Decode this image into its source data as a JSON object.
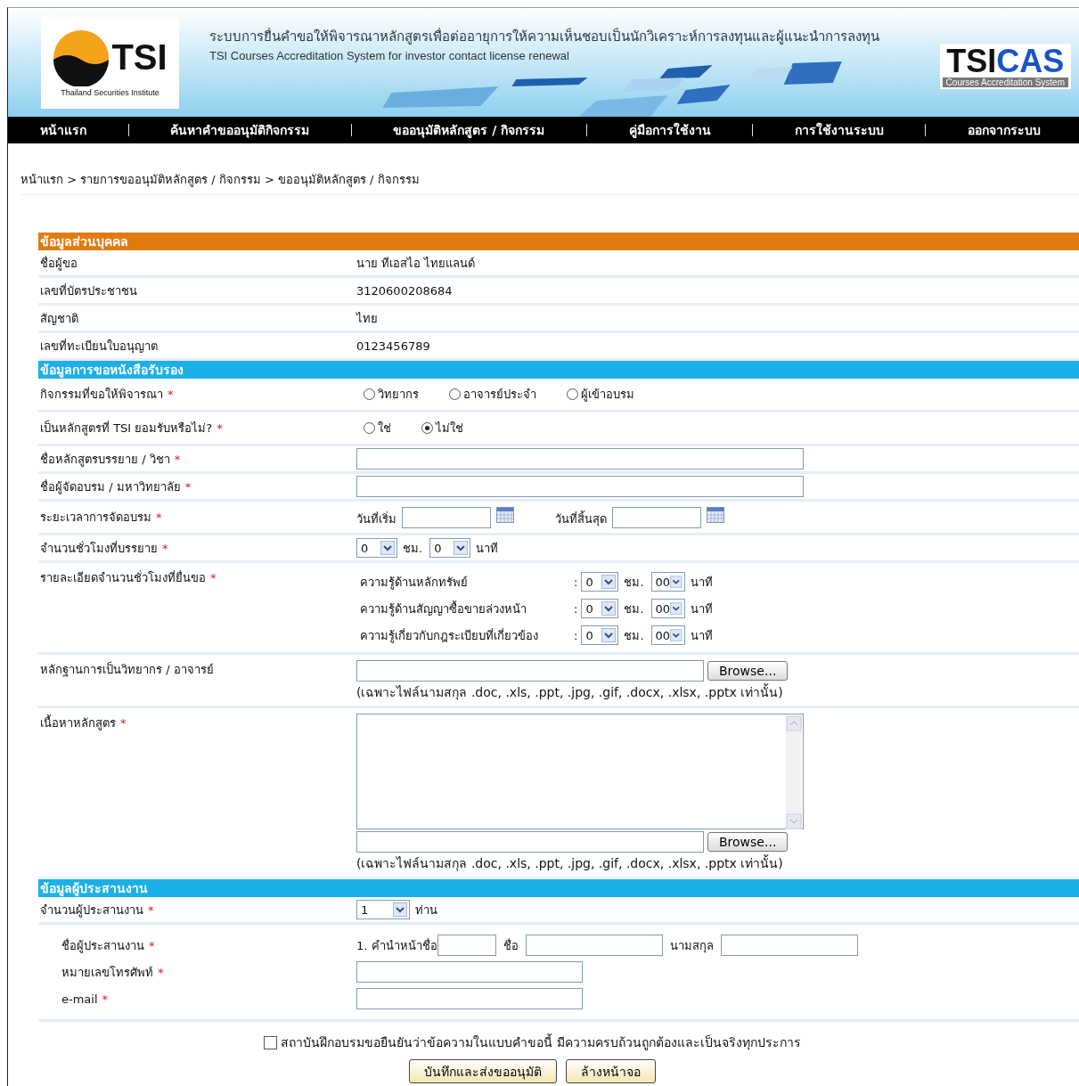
{
  "header": {
    "logo_mark": "TSI",
    "logo_caption": "Thailand Securities Institute",
    "title_th": "ระบบการยื่นคำขอให้พิจารณาหลักสูตรเพื่อต่ออายุการให้ความเห็นชอบเป็นนักวิเคราะห์การลงทุนและผู้แนะนำการลงทุน",
    "title_en": "TSI Courses Accreditation System for investor contact license renewal",
    "brand_a": "TSI",
    "brand_b": "CAS",
    "brand_caption": "Courses Accreditation System"
  },
  "nav": [
    {
      "label": "หน้าแรก"
    },
    {
      "label": "ค้นหาคำขออนุมัติกิจกรรม"
    },
    {
      "label": "ขออนุมัติหลักสูตร / กิจกรรม"
    },
    {
      "label": "คู่มือการใช้งาน"
    },
    {
      "label": "การใช้งานระบบ"
    },
    {
      "label": "ออกจากระบบ"
    }
  ],
  "breadcrumb": "หน้าแรก > รายการขออนุมัติหลักสูตร / กิจกรรม > ขออนุมัติหลักสูตร / กิจกรรม",
  "sections": [
    {
      "title": "ข้อมูลส่วนบุคคล",
      "color": "#e07b10",
      "rows": [
        {
          "kind": "info",
          "label": "ชื่อผู้ขอ",
          "value": "นาย ทีเอสไอ ไทยแลนด์"
        },
        {
          "kind": "info",
          "label": "เลขที่บัตรประชาชน",
          "value": "3120600208684"
        },
        {
          "kind": "info",
          "label": "สัญชาติ",
          "value": "ไทย"
        },
        {
          "kind": "info",
          "label": "เลขที่ทะเบียนใบอนุญาต",
          "value": "0123456789"
        }
      ]
    },
    {
      "title": "ข้อมูลการขอหนังสือรับรอง",
      "color": "#1cb0e8",
      "rows": [
        {
          "kind": "radio",
          "label": "กิจกรรมที่ขอให้พิจารณา",
          "mark": "*",
          "options": [
            {
              "label": "วิทยากร",
              "selected": false
            },
            {
              "label": "อาจารย์ประจำ",
              "selected": false
            },
            {
              "label": "ผู้เข้าอบรม",
              "selected": false
            }
          ]
        },
        {
          "kind": "radio",
          "label": "เป็นหลักสูตรที่ TSI ยอมรับหรือไม่?",
          "mark": "*",
          "options": [
            {
              "label": "ใช่",
              "selected": false
            },
            {
              "label": "ไม่ใช่",
              "selected": true
            }
          ]
        },
        {
          "kind": "text",
          "label": "ชื่อหลักสูตรบรรยาย / วิชา",
          "mark": "*"
        },
        {
          "kind": "text",
          "label": "ชื่อผู้จัดอบรม / มหาวิทยาลัย",
          "mark": "*"
        },
        {
          "kind": "dates",
          "label": "ระยะเวลาการจัดอบรม",
          "mark": "*",
          "start_label": "วันที่เริ่ม",
          "end_label": "วันที่สิ้นสุด"
        },
        {
          "kind": "duration",
          "label": "จำนวนชั่วโมงที่บรรยาย",
          "mark": "*",
          "hours": "0",
          "hours_unit": "ชม.",
          "minutes": "0",
          "minutes_unit": "นาที"
        },
        {
          "kind": "breakdown",
          "label": "รายละเอียดจำนวนชั่วโมงที่ยื่นขอ",
          "mark": "*",
          "items": [
            {
              "label": "ความรู้ด้านหลักทรัพย์",
              "sep": ":",
              "hours": "0",
              "hours_unit": "ชม.",
              "minutes": "00",
              "minutes_unit": "นาที"
            },
            {
              "label": "ความรู้ด้านสัญญาซื้อขายล่วงหน้า",
              "sep": ":",
              "hours": "0",
              "hours_unit": "ชม.",
              "minutes": "00",
              "minutes_unit": "นาที"
            },
            {
              "label": "ความรู้เกี่ยวกับกฎระเบียบที่เกี่ยวข้อง",
              "sep": ":",
              "hours": "0",
              "hours_unit": "ชม.",
              "minutes": "00",
              "minutes_unit": "นาที"
            }
          ]
        },
        {
          "kind": "file",
          "label": "หลักฐานการเป็นวิทยากร / อาจารย์",
          "button": "Browse...",
          "note": "(เฉพาะไฟล์นามสกุล .doc, .xls, .ppt, .jpg, .gif, .docx, .xlsx, .pptx เท่านั้น)"
        },
        {
          "kind": "content",
          "label": "เนื้อหาหลักสูตร",
          "mark": "*",
          "button": "Browse...",
          "note": "(เฉพาะไฟล์นามสกุล .doc, .xls, .ppt, .jpg, .gif, .docx, .xlsx, .pptx เท่านั้น)"
        }
      ]
    },
    {
      "title": "ข้อมูลผู้ประสานงาน",
      "color": "#1cb0e8",
      "rows": [
        {
          "kind": "count",
          "label": "จำนวนผู้ประสานงาน",
          "mark": "*",
          "value": "1",
          "unit": "ท่าน"
        },
        {
          "kind": "contact",
          "lines": [
            {
              "kind": "name",
              "label": "ชื่อผู้ประสานงาน",
              "mark": "*",
              "prefix_label": "1. คำนำหน้าชื่อ",
              "first_label": "ชื่อ",
              "last_label": "นามสกุล"
            },
            {
              "kind": "field",
              "label": "หมายเลขโทรศัพท์",
              "mark": "*"
            },
            {
              "kind": "field",
              "label": "e-mail",
              "mark": "*"
            }
          ]
        }
      ]
    }
  ],
  "confirm": {
    "label": "สถาบันฝึกอบรมขอยืนยันว่าข้อความในแบบคำขอนี้ มีความครบถ้วนถูกต้องและเป็นจริงทุกประการ",
    "checked": false
  },
  "buttons": [
    {
      "label": "บันทึกและส่งขออนุมัติ"
    },
    {
      "label": "ล้างหน้าจอ"
    }
  ]
}
